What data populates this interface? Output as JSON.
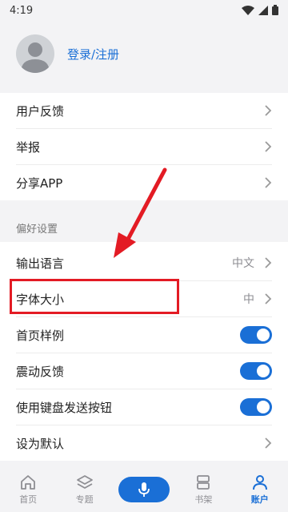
{
  "status": {
    "time": "4:19"
  },
  "profile": {
    "login_label": "登录/注册"
  },
  "menu": {
    "feedback": "用户反馈",
    "report": "举报",
    "share": "分享APP"
  },
  "preferences": {
    "section_title": "偏好设置",
    "output_language": {
      "label": "输出语言",
      "value": "中文"
    },
    "font_size": {
      "label": "字体大小",
      "value": "中"
    },
    "homepage_example": {
      "label": "首页样例",
      "on": true
    },
    "vibration_feedback": {
      "label": "震动反馈",
      "on": true
    },
    "keyboard_send": {
      "label": "使用键盘发送按钮",
      "on": true
    },
    "set_default": {
      "label": "设为默认"
    }
  },
  "tabbar": {
    "home": "首页",
    "topics": "专题",
    "bookshelf": "书架",
    "account": "账户",
    "active": "account"
  },
  "colors": {
    "accent": "#1a6fd6",
    "annotation": "#e31b24",
    "background": "#f3f3f5"
  },
  "icons": [
    "wifi-icon",
    "signal-icon",
    "battery-icon",
    "avatar-icon",
    "chevron-right-icon",
    "home-icon",
    "layers-icon",
    "microphone-icon",
    "bookshelf-icon",
    "person-icon"
  ]
}
